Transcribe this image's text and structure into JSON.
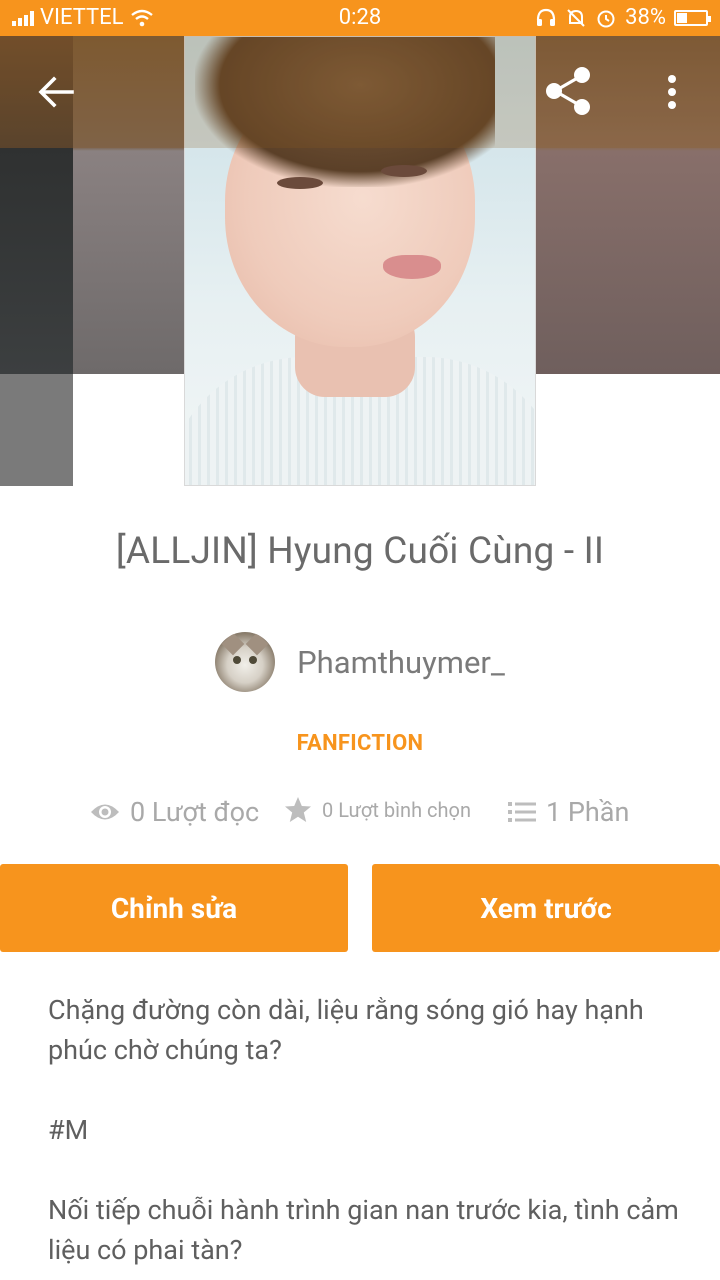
{
  "status_bar": {
    "carrier": "VIETTEL",
    "time": "0:28",
    "battery": "38%",
    "battery_level": 0.38
  },
  "app_bar": {
    "back_icon": "arrow-left-icon",
    "share_icon": "share-icon",
    "more_icon": "more-vertical-icon"
  },
  "story": {
    "title": "[ALLJIN] Hyung Cuối Cùng - II",
    "author": "Phamthuymer_",
    "category": "FANFICTION",
    "stats": {
      "reads": "0 Lượt đọc",
      "votes": "0 Lượt bình chọn",
      "parts": "1 Phần"
    }
  },
  "actions": {
    "edit_label": "Chỉnh sửa",
    "preview_label": "Xem trước"
  },
  "description": {
    "paragraphs": [
      "Chặng đường còn dài, liệu rằng sóng gió hay hạnh phúc chờ chúng ta?",
      "#M",
      "Nối tiếp chuỗi hành trình gian nan trước kia, tình cảm liệu có phai tàn?"
    ]
  },
  "colors": {
    "accent": "#f7941d",
    "text": "#6a6a6a",
    "muted": "#a9a9a9"
  }
}
